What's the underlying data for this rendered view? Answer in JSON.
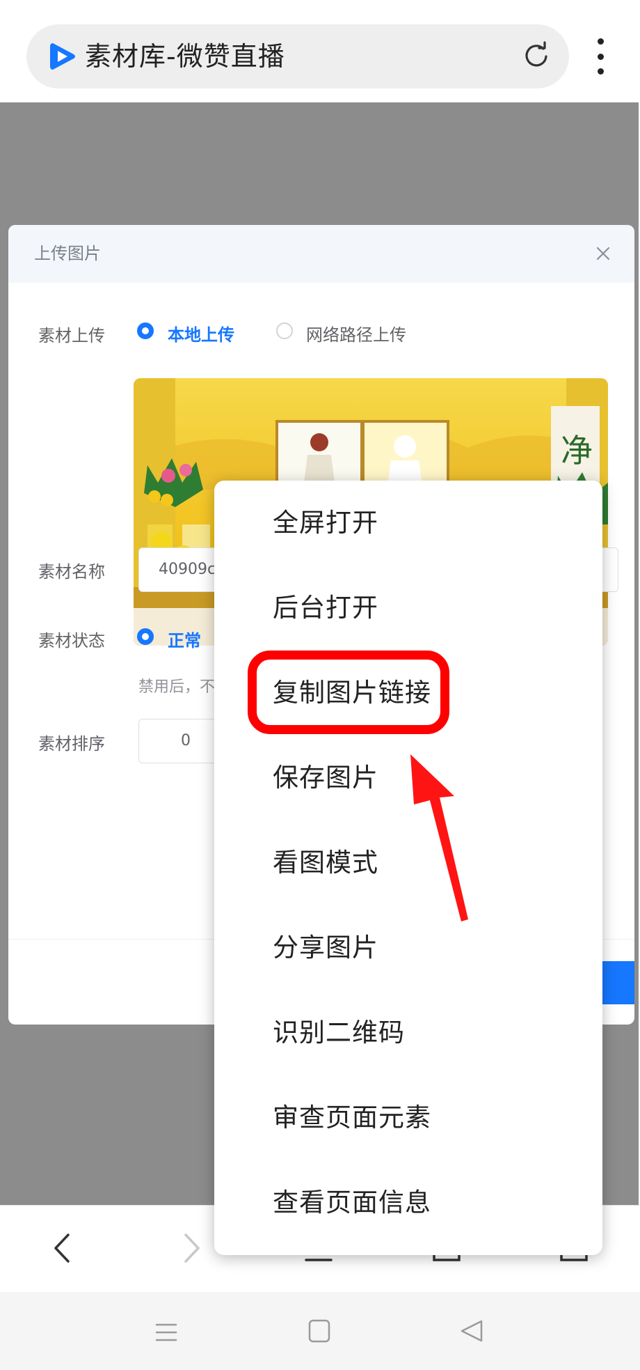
{
  "browser": {
    "url_title": "素材库-微赞直播",
    "reload_icon": "refresh-icon",
    "more_icon": "more-vertical-icon",
    "brand_color": "#1677ff"
  },
  "modal": {
    "title": "上传图片",
    "close_icon": "close-icon",
    "upload": {
      "label": "素材上传",
      "option_local": "本地上传",
      "option_network": "网络路径上传",
      "selected": "本地上传"
    },
    "name": {
      "label": "素材名称",
      "value": "40909c"
    },
    "status": {
      "label": "素材状态",
      "option_normal": "正常",
      "hint": "禁用后，不"
    },
    "sort": {
      "label": "素材排序",
      "value": "0"
    }
  },
  "context_menu": {
    "items": [
      "全屏打开",
      "后台打开",
      "复制图片链接",
      "保存图片",
      "看图模式",
      "分享图片",
      "识别二维码",
      "审查页面元素",
      "查看页面信息"
    ],
    "highlighted": "复制图片链接",
    "highlight_color": "#ff0000"
  },
  "bottom_nav": {
    "icons": [
      "back-icon",
      "forward-icon",
      "menu-icon",
      "home-icon",
      "tabs-icon"
    ]
  },
  "system_nav": {
    "icons": [
      "recents-icon",
      "home-square-icon",
      "back-triangle-icon"
    ]
  }
}
